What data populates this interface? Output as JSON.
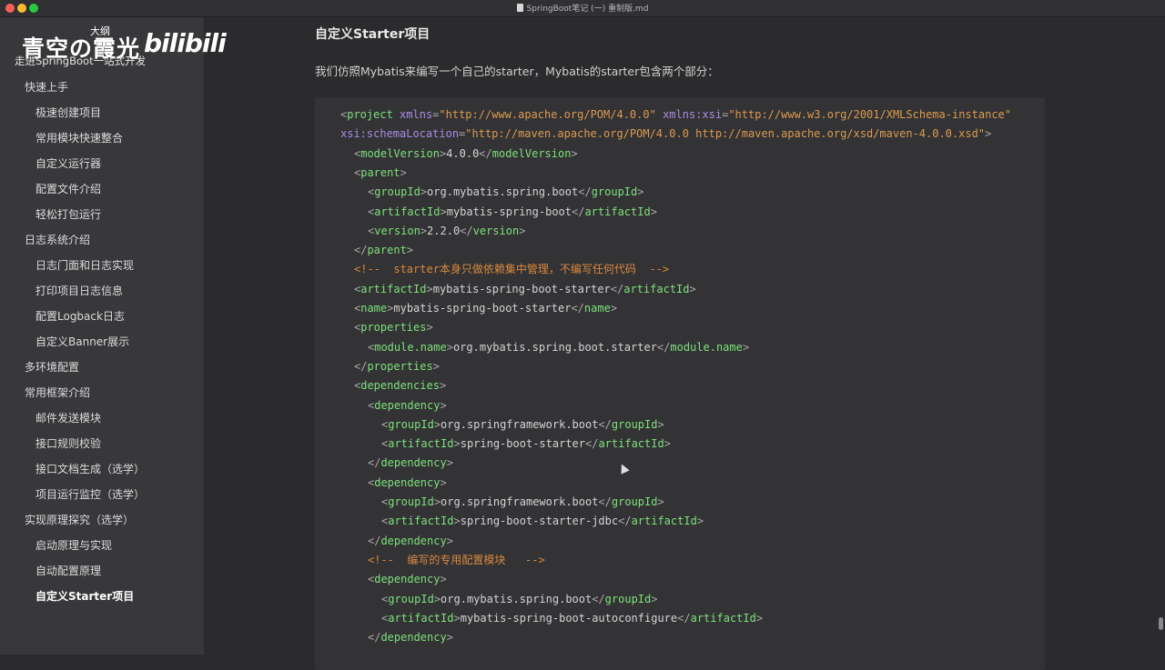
{
  "window": {
    "title": "SpringBoot笔记 (一) 重制版.md"
  },
  "watermark": {
    "channel": "青空の霞光",
    "badge": "大纲",
    "subtitle": "走进SpringBoot一站式开发",
    "logo": "bilibili"
  },
  "sidebar": {
    "items": [
      {
        "label": "快速上手",
        "level": 1
      },
      {
        "label": "极速创建项目",
        "level": 2
      },
      {
        "label": "常用模块快速整合",
        "level": 2
      },
      {
        "label": "自定义运行器",
        "level": 2
      },
      {
        "label": "配置文件介绍",
        "level": 2
      },
      {
        "label": "轻松打包运行",
        "level": 2
      },
      {
        "label": "日志系统介绍",
        "level": 1
      },
      {
        "label": "日志门面和日志实现",
        "level": 2
      },
      {
        "label": "打印项目日志信息",
        "level": 2
      },
      {
        "label": "配置Logback日志",
        "level": 2
      },
      {
        "label": "自定义Banner展示",
        "level": 2
      },
      {
        "label": "多环境配置",
        "level": 1
      },
      {
        "label": "常用框架介绍",
        "level": 1
      },
      {
        "label": "邮件发送模块",
        "level": 2
      },
      {
        "label": "接口规则校验",
        "level": 2
      },
      {
        "label": "接口文档生成（选学）",
        "level": 2
      },
      {
        "label": "项目运行监控（选学）",
        "level": 2
      },
      {
        "label": "实现原理探究（选学）",
        "level": 1
      },
      {
        "label": "启动原理与实现",
        "level": 2
      },
      {
        "label": "自动配置原理",
        "level": 2
      },
      {
        "label": "自定义Starter项目",
        "level": 2,
        "active": true
      }
    ]
  },
  "main": {
    "heading": "自定义Starter项目",
    "paragraph": "我们仿照Mybatis来编写一个自己的starter，Mybatis的starter包含两个部分：",
    "code": [
      {
        "indent": 0,
        "tokens": [
          [
            "pun",
            "<"
          ],
          [
            "tag",
            "project"
          ],
          [
            "txt",
            " "
          ],
          [
            "attr",
            "xmlns"
          ],
          [
            "pun",
            "="
          ],
          [
            "val",
            "\"http://www.apache.org/POM/4.0.0\""
          ],
          [
            "txt",
            " "
          ],
          [
            "attr",
            "xmlns:xsi"
          ],
          [
            "pun",
            "="
          ],
          [
            "val",
            "\"http://www.w3.org/2001/XMLSchema-instance\""
          ]
        ]
      },
      {
        "indent": 0,
        "tokens": [
          [
            "attr",
            "xsi:schemaLocation"
          ],
          [
            "pun",
            "="
          ],
          [
            "val",
            "\"http://maven.apache.org/POM/4.0.0 http://maven.apache.org/xsd/maven-4.0.0.xsd\""
          ],
          [
            "pun",
            ">"
          ]
        ]
      },
      {
        "indent": 1,
        "tokens": [
          [
            "pun",
            "<"
          ],
          [
            "tag",
            "modelVersion"
          ],
          [
            "pun",
            ">"
          ],
          [
            "txt",
            "4.0.0"
          ],
          [
            "pun",
            "</"
          ],
          [
            "tag",
            "modelVersion"
          ],
          [
            "pun",
            ">"
          ]
        ]
      },
      {
        "indent": 1,
        "tokens": [
          [
            "pun",
            "<"
          ],
          [
            "tag",
            "parent"
          ],
          [
            "pun",
            ">"
          ]
        ]
      },
      {
        "indent": 2,
        "tokens": [
          [
            "pun",
            "<"
          ],
          [
            "tag",
            "groupId"
          ],
          [
            "pun",
            ">"
          ],
          [
            "txt",
            "org.mybatis.spring.boot"
          ],
          [
            "pun",
            "</"
          ],
          [
            "tag",
            "groupId"
          ],
          [
            "pun",
            ">"
          ]
        ]
      },
      {
        "indent": 2,
        "tokens": [
          [
            "pun",
            "<"
          ],
          [
            "tag",
            "artifactId"
          ],
          [
            "pun",
            ">"
          ],
          [
            "txt",
            "mybatis-spring-boot"
          ],
          [
            "pun",
            "</"
          ],
          [
            "tag",
            "artifactId"
          ],
          [
            "pun",
            ">"
          ]
        ]
      },
      {
        "indent": 2,
        "tokens": [
          [
            "pun",
            "<"
          ],
          [
            "tag",
            "version"
          ],
          [
            "pun",
            ">"
          ],
          [
            "txt",
            "2.2.0"
          ],
          [
            "pun",
            "</"
          ],
          [
            "tag",
            "version"
          ],
          [
            "pun",
            ">"
          ]
        ]
      },
      {
        "indent": 1,
        "tokens": [
          [
            "pun",
            "</"
          ],
          [
            "tag",
            "parent"
          ],
          [
            "pun",
            ">"
          ]
        ]
      },
      {
        "indent": 1,
        "tokens": [
          [
            "com",
            "<!--  starter本身只做依赖集中管理，不编写任何代码  -->"
          ]
        ]
      },
      {
        "indent": 1,
        "tokens": [
          [
            "pun",
            "<"
          ],
          [
            "tag",
            "artifactId"
          ],
          [
            "pun",
            ">"
          ],
          [
            "txt",
            "mybatis-spring-boot-starter"
          ],
          [
            "pun",
            "</"
          ],
          [
            "tag",
            "artifactId"
          ],
          [
            "pun",
            ">"
          ]
        ]
      },
      {
        "indent": 1,
        "tokens": [
          [
            "pun",
            "<"
          ],
          [
            "tag",
            "name"
          ],
          [
            "pun",
            ">"
          ],
          [
            "txt",
            "mybatis-spring-boot-starter"
          ],
          [
            "pun",
            "</"
          ],
          [
            "tag",
            "name"
          ],
          [
            "pun",
            ">"
          ]
        ]
      },
      {
        "indent": 1,
        "tokens": [
          [
            "pun",
            "<"
          ],
          [
            "tag",
            "properties"
          ],
          [
            "pun",
            ">"
          ]
        ]
      },
      {
        "indent": 2,
        "tokens": [
          [
            "pun",
            "<"
          ],
          [
            "tag",
            "module.name"
          ],
          [
            "pun",
            ">"
          ],
          [
            "txt",
            "org.mybatis.spring.boot.starter"
          ],
          [
            "pun",
            "</"
          ],
          [
            "tag",
            "module.name"
          ],
          [
            "pun",
            ">"
          ]
        ]
      },
      {
        "indent": 1,
        "tokens": [
          [
            "pun",
            "</"
          ],
          [
            "tag",
            "properties"
          ],
          [
            "pun",
            ">"
          ]
        ]
      },
      {
        "indent": 1,
        "tokens": [
          [
            "pun",
            "<"
          ],
          [
            "tag",
            "dependencies"
          ],
          [
            "pun",
            ">"
          ]
        ]
      },
      {
        "indent": 2,
        "tokens": [
          [
            "pun",
            "<"
          ],
          [
            "tag",
            "dependency"
          ],
          [
            "pun",
            ">"
          ]
        ]
      },
      {
        "indent": 3,
        "tokens": [
          [
            "pun",
            "<"
          ],
          [
            "tag",
            "groupId"
          ],
          [
            "pun",
            ">"
          ],
          [
            "txt",
            "org.springframework.boot"
          ],
          [
            "pun",
            "</"
          ],
          [
            "tag",
            "groupId"
          ],
          [
            "pun",
            ">"
          ]
        ]
      },
      {
        "indent": 3,
        "tokens": [
          [
            "pun",
            "<"
          ],
          [
            "tag",
            "artifactId"
          ],
          [
            "pun",
            ">"
          ],
          [
            "txt",
            "spring-boot-starter"
          ],
          [
            "pun",
            "</"
          ],
          [
            "tag",
            "artifactId"
          ],
          [
            "pun",
            ">"
          ]
        ]
      },
      {
        "indent": 2,
        "tokens": [
          [
            "pun",
            "</"
          ],
          [
            "tag",
            "dependency"
          ],
          [
            "pun",
            ">"
          ]
        ]
      },
      {
        "indent": 2,
        "tokens": [
          [
            "pun",
            "<"
          ],
          [
            "tag",
            "dependency"
          ],
          [
            "pun",
            ">"
          ]
        ]
      },
      {
        "indent": 3,
        "tokens": [
          [
            "pun",
            "<"
          ],
          [
            "tag",
            "groupId"
          ],
          [
            "pun",
            ">"
          ],
          [
            "txt",
            "org.springframework.boot"
          ],
          [
            "pun",
            "</"
          ],
          [
            "tag",
            "groupId"
          ],
          [
            "pun",
            ">"
          ]
        ]
      },
      {
        "indent": 3,
        "tokens": [
          [
            "pun",
            "<"
          ],
          [
            "tag",
            "artifactId"
          ],
          [
            "pun",
            ">"
          ],
          [
            "txt",
            "spring-boot-starter-jdbc"
          ],
          [
            "pun",
            "</"
          ],
          [
            "tag",
            "artifactId"
          ],
          [
            "pun",
            ">"
          ]
        ]
      },
      {
        "indent": 2,
        "tokens": [
          [
            "pun",
            "</"
          ],
          [
            "tag",
            "dependency"
          ],
          [
            "pun",
            ">"
          ]
        ]
      },
      {
        "indent": 2,
        "tokens": [
          [
            "com",
            "<!--  编写的专用配置模块   -->"
          ]
        ]
      },
      {
        "indent": 2,
        "tokens": [
          [
            "pun",
            "<"
          ],
          [
            "tag",
            "dependency"
          ],
          [
            "pun",
            ">"
          ]
        ]
      },
      {
        "indent": 3,
        "tokens": [
          [
            "pun",
            "<"
          ],
          [
            "tag",
            "groupId"
          ],
          [
            "pun",
            ">"
          ],
          [
            "txt",
            "org.mybatis.spring.boot"
          ],
          [
            "pun",
            "</"
          ],
          [
            "tag",
            "groupId"
          ],
          [
            "pun",
            ">"
          ]
        ]
      },
      {
        "indent": 3,
        "tokens": [
          [
            "pun",
            "<"
          ],
          [
            "tag",
            "artifactId"
          ],
          [
            "pun",
            ">"
          ],
          [
            "txt",
            "mybatis-spring-boot-autoconfigure"
          ],
          [
            "pun",
            "</"
          ],
          [
            "tag",
            "artifactId"
          ],
          [
            "pun",
            ">"
          ]
        ]
      },
      {
        "indent": 2,
        "tokens": [
          [
            "pun",
            "</"
          ],
          [
            "tag",
            "dependency"
          ],
          [
            "pun",
            ">"
          ]
        ]
      }
    ]
  },
  "colors": {
    "tag": "#7ee07a",
    "attribute": "#a98ce0",
    "string": "#dc9a4e",
    "comment": "#d9893c",
    "background": "#2b2b2d"
  }
}
